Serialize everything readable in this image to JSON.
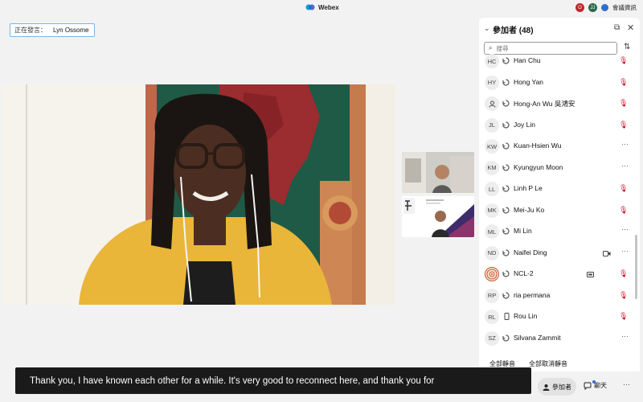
{
  "window": {
    "app_title": "Webex",
    "avatar_1": "O",
    "avatar_2": "JJ",
    "meeting_info": "會議資訊"
  },
  "speaking": {
    "label": "正在發言：",
    "name": "Lyn Ossome"
  },
  "participants_panel": {
    "title": "參加者 (48)",
    "search_placeholder": "搜尋",
    "participants": [
      {
        "initials": "HC",
        "name": "Han Chu",
        "status": "muted"
      },
      {
        "initials": "HY",
        "name": "Hong Yan",
        "status": "muted"
      },
      {
        "initials": "",
        "name": "Hong-An Wu 吳鴻安",
        "status": "muted",
        "avatar": "person-icon"
      },
      {
        "initials": "JL",
        "name": "Joy Lin",
        "status": "muted"
      },
      {
        "initials": "KW",
        "name": "Kuan-Hsien Wu",
        "status": "more"
      },
      {
        "initials": "KM",
        "name": "Kyungyun Moon",
        "status": "more"
      },
      {
        "initials": "LL",
        "name": "Linh P Le",
        "status": "muted"
      },
      {
        "initials": "MK",
        "name": "Mei-Ju Ko",
        "status": "muted"
      },
      {
        "initials": "ML",
        "name": "Mi Lin",
        "status": "more"
      },
      {
        "initials": "ND",
        "name": "Naifei Ding",
        "status": "more",
        "extra": "video-icon"
      },
      {
        "initials": "",
        "name": "NCL-2",
        "status": "muted",
        "avatar": "logo-image",
        "extra": "cc-icon"
      },
      {
        "initials": "RP",
        "name": "ria permana",
        "status": "muted"
      },
      {
        "initials": "RL",
        "name": "Rou Lin",
        "status": "muted",
        "device": "phone-icon"
      },
      {
        "initials": "SZ",
        "name": "Silvana Zammit",
        "status": "more"
      }
    ],
    "mute_all": "全部靜音",
    "unmute_all": "全部取消靜音"
  },
  "caption": {
    "text": "Thank you, I have known each other for a while. It's very good to reconnect here, and thank you for"
  },
  "controls": {
    "participants_label": "參加者",
    "chat_label": "聊天",
    "more_label": "···"
  },
  "colors": {
    "mute_red": "#d0021b",
    "caption_bg": "#1a1a1a",
    "accent_blue": "#2f6fd1",
    "speaker_shirt": "#e9b63a",
    "backdrop_green": "#1f5a46"
  }
}
